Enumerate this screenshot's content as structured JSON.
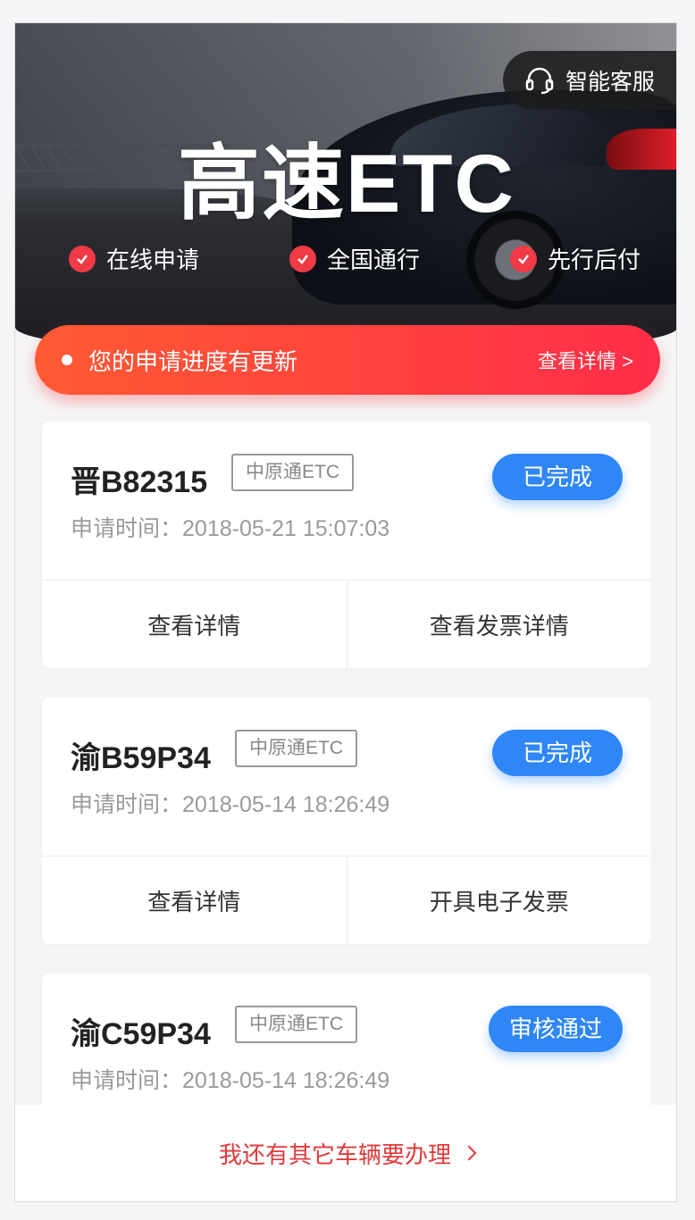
{
  "hero": {
    "service_label": "智能客服",
    "title": "高速ETC",
    "features": [
      "在线申请",
      "全国通行",
      "先行后付"
    ]
  },
  "progress": {
    "message": "您的申请进度有更新",
    "link": "查看详情 >"
  },
  "applications": [
    {
      "plate": "晋B82315",
      "provider": "中原通ETC",
      "status": "已完成",
      "time_label": "申请时间：",
      "time": "2018-05-21 15:07:03",
      "actions": [
        "查看详情",
        "查看发票详情"
      ]
    },
    {
      "plate": "渝B59P34",
      "provider": "中原通ETC",
      "status": "已完成",
      "time_label": "申请时间：",
      "time": "2018-05-14 18:26:49",
      "actions": [
        "查看详情",
        "开具电子发票"
      ]
    },
    {
      "plate": "渝C59P34",
      "provider": "中原通ETC",
      "status": "审核通过",
      "time_label": "申请时间：",
      "time": "2018-05-14 18:26:49",
      "actions": []
    }
  ],
  "bottom": {
    "label": "我还有其它车辆要办理"
  },
  "colors": {
    "accent_red": "#ff2d49",
    "status_blue": "#2f86f6",
    "check_red": "#f03a45"
  }
}
